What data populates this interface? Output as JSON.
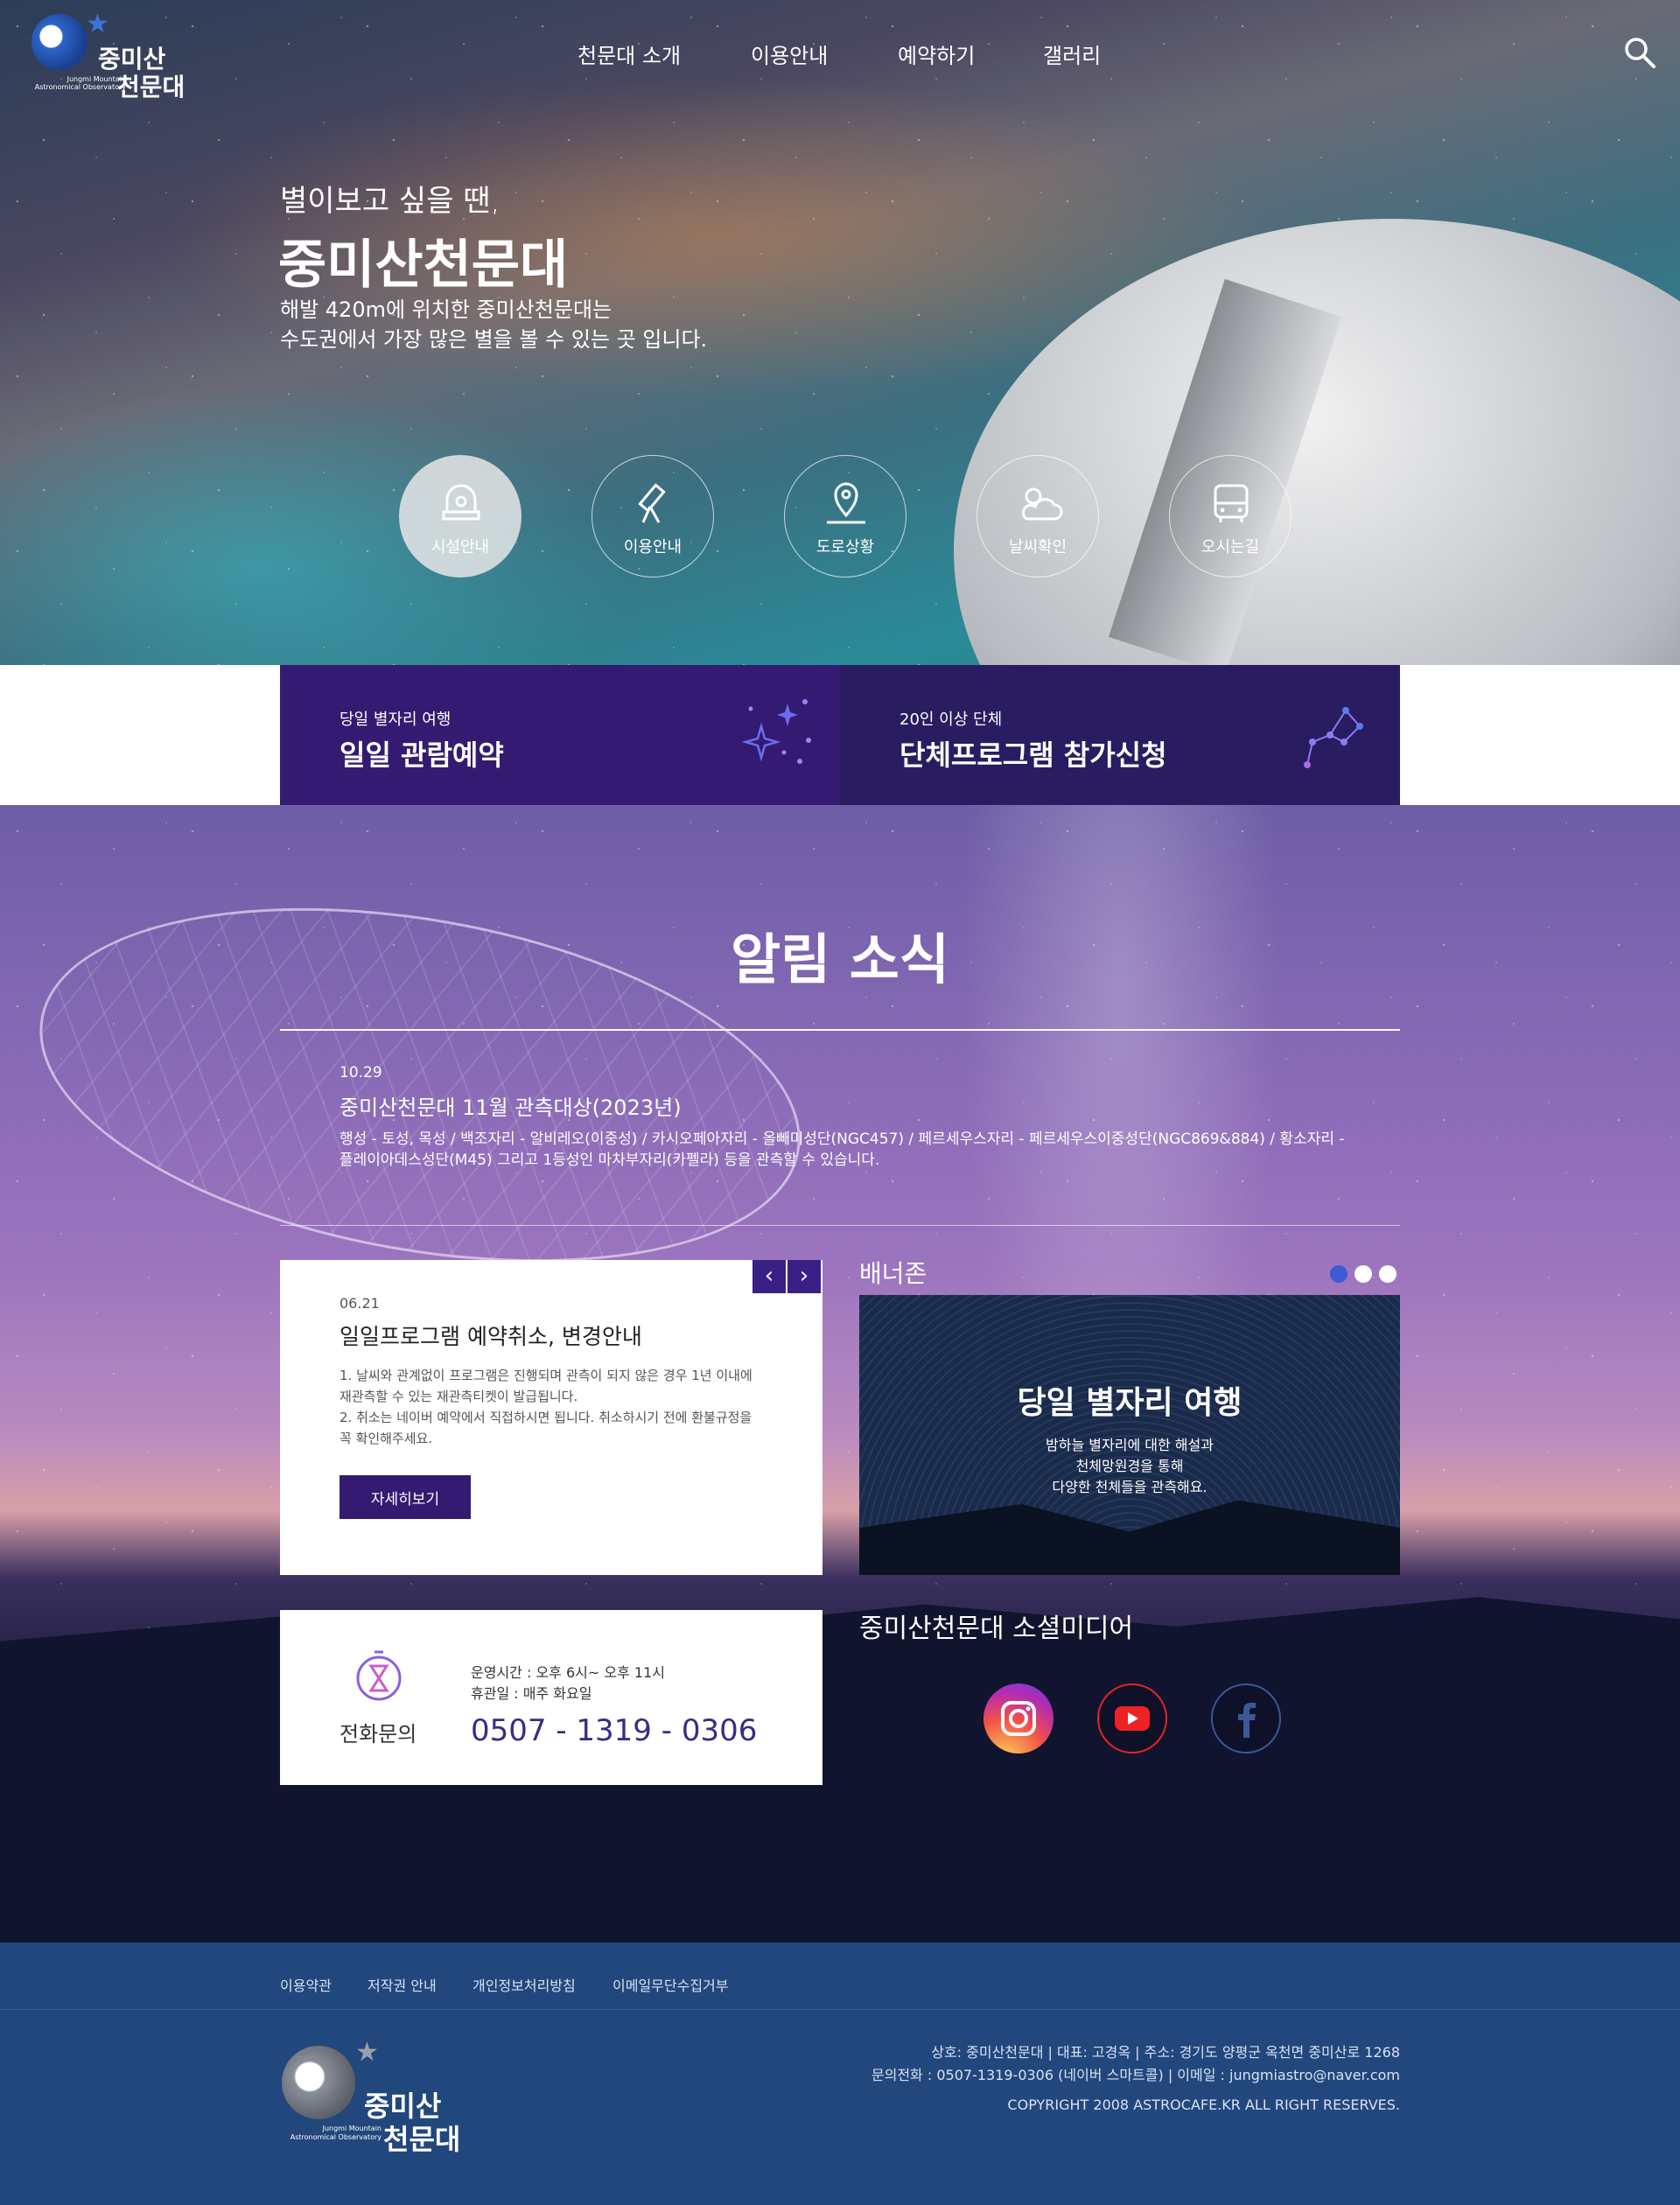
{
  "header": {
    "logo_name_line1": "중미산",
    "logo_name_line2": "천문대",
    "logo_en": "Jungmi Mountain Astronomical Observatory",
    "menu": [
      "천문대 소개",
      "이용안내",
      "예약하기",
      "갤러리"
    ]
  },
  "hero": {
    "tagline": "별이보고 싶을 땐,",
    "title": "중미산천문대",
    "desc1": "해발 420m에 위치한 중미산천문대는",
    "desc2": "수도권에서 가장 많은 별을 볼 수 있는 곳 입니다.",
    "quick_links": [
      {
        "label": "시설안내",
        "icon": "observatory-icon"
      },
      {
        "label": "이용안내",
        "icon": "telescope-icon"
      },
      {
        "label": "도로상황",
        "icon": "map-pin-road-icon"
      },
      {
        "label": "날씨확인",
        "icon": "sun-cloud-icon"
      },
      {
        "label": "오시는길",
        "icon": "bus-icon"
      }
    ]
  },
  "reserve": {
    "daily_sub": "당일 별자리 여행",
    "daily_title": "일일 관람예약",
    "group_sub": "20인 이상 단체",
    "group_title": "단체프로그램 참가신청"
  },
  "news": {
    "title": "알림 소식",
    "date": "10.29",
    "headline": "중미산천문대 11월 관측대상(2023년)",
    "body": "행성 - 토성, 목성 / 백조자리 - 알비레오(이중성) / 카시오페아자리 - 올빼미성단(NGC457) / 페르세우스자리 - 페르세우스이중성단(NGC869&884) / 황소자리 - 플레이아데스성단(M45) 그리고 1등성인 마차부자리(카펠라) 등을 관측할 수 있습니다."
  },
  "notice": {
    "date": "06.21",
    "title": "일일프로그램 예약취소, 변경안내",
    "body1": "1. 날씨와 관계없이 프로그램은 진행되며 관측이 되지 않은 경우 1년 이내에 재관측할 수 있는 재관측티켓이 발급됩니다.",
    "body2": "2. 취소는 네이버 예약에서 직접하시면 됩니다. 취소하시기 전에 환불규정을 꼭 확인해주세요.",
    "button": "자세히보기"
  },
  "banner": {
    "label": "배너존",
    "title": "당일 별자리 여행",
    "desc1": "밤하늘 별자리에 대한 해설과",
    "desc2": "천체망원경을 통해",
    "desc3": "다양한 천체들을 관측해요."
  },
  "contact": {
    "label": "전화문의",
    "hours": "운영시간 : 오후 6시~ 오후 11시",
    "closed": "휴관일 : 매주 화요일",
    "phone": "0507 - 1319 - 0306"
  },
  "social": {
    "label": "중미산천문대 소셜미디어",
    "items": [
      "instagram-icon",
      "youtube-icon",
      "facebook-icon"
    ]
  },
  "footer": {
    "links": [
      "이용약관",
      "저작권 안내",
      "개인정보처리방침",
      "이메일무단수집거부"
    ],
    "info1": "상호: 중미산천문대 | 대표: 고경옥 | 주소: 경기도 양평군 옥천면 중미산로 1268",
    "info2": "문의전화 : 0507-1319-0306 (네이버 스마트콜) | 이메일 : jungmiastro@naver.com",
    "copyright": "COPYRIGHT 2008 ASTROCAFE.KR ALL RIGHT RESERVES."
  },
  "colors": {
    "primary": "#341b71",
    "footer": "#22477c",
    "phone": "#3b2a85"
  }
}
